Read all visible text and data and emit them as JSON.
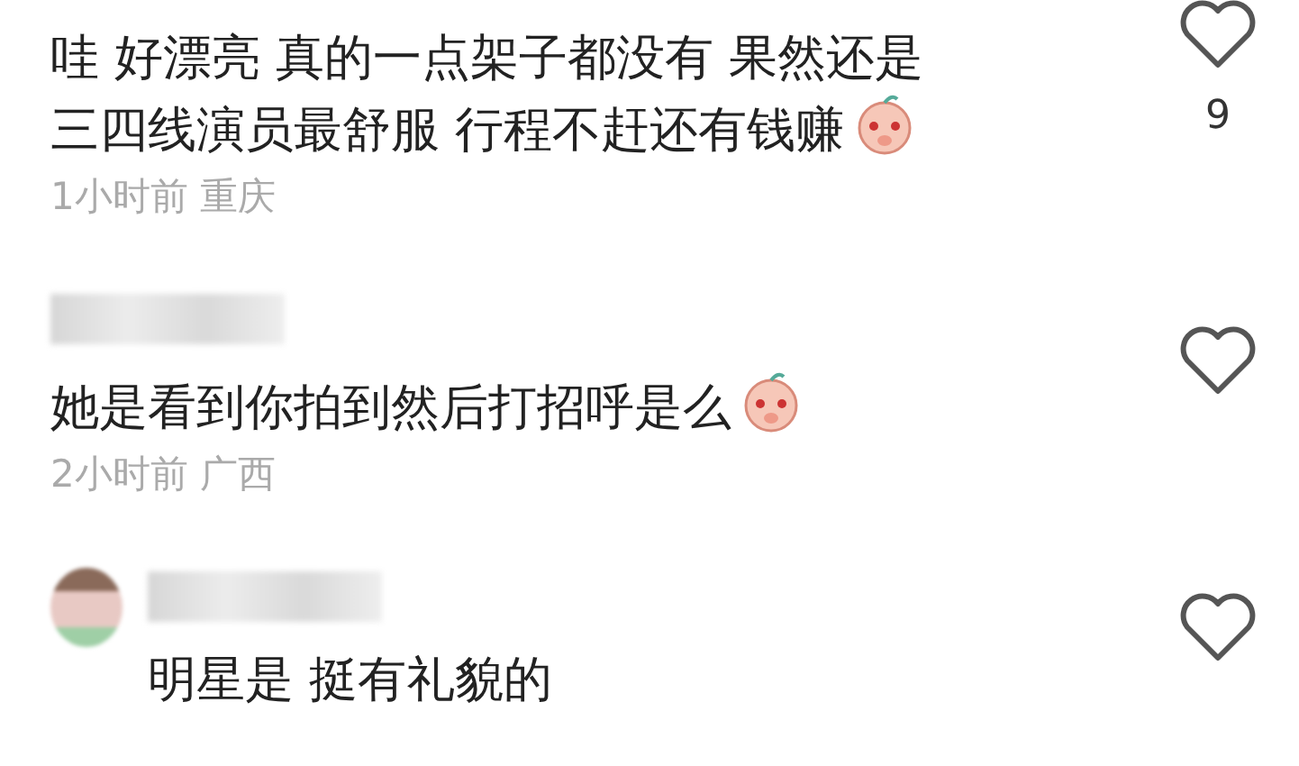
{
  "comments": [
    {
      "show_name": false,
      "show_avatar": false,
      "lines": [
        "哇 好漂亮 真的一点架子都没有 果然还是",
        "三四线演员最舒服 行程不赶还有钱赚"
      ],
      "has_emoji": true,
      "meta": "1小时前 重庆",
      "likes": "9"
    },
    {
      "show_name": true,
      "show_avatar": false,
      "lines": [
        "她是看到你拍到然后打招呼是么"
      ],
      "has_emoji": true,
      "meta": "2小时前 广西"
    },
    {
      "show_name": true,
      "show_avatar": true,
      "lines": [
        "明星是 挺有礼貌的"
      ],
      "has_emoji": false
    }
  ]
}
